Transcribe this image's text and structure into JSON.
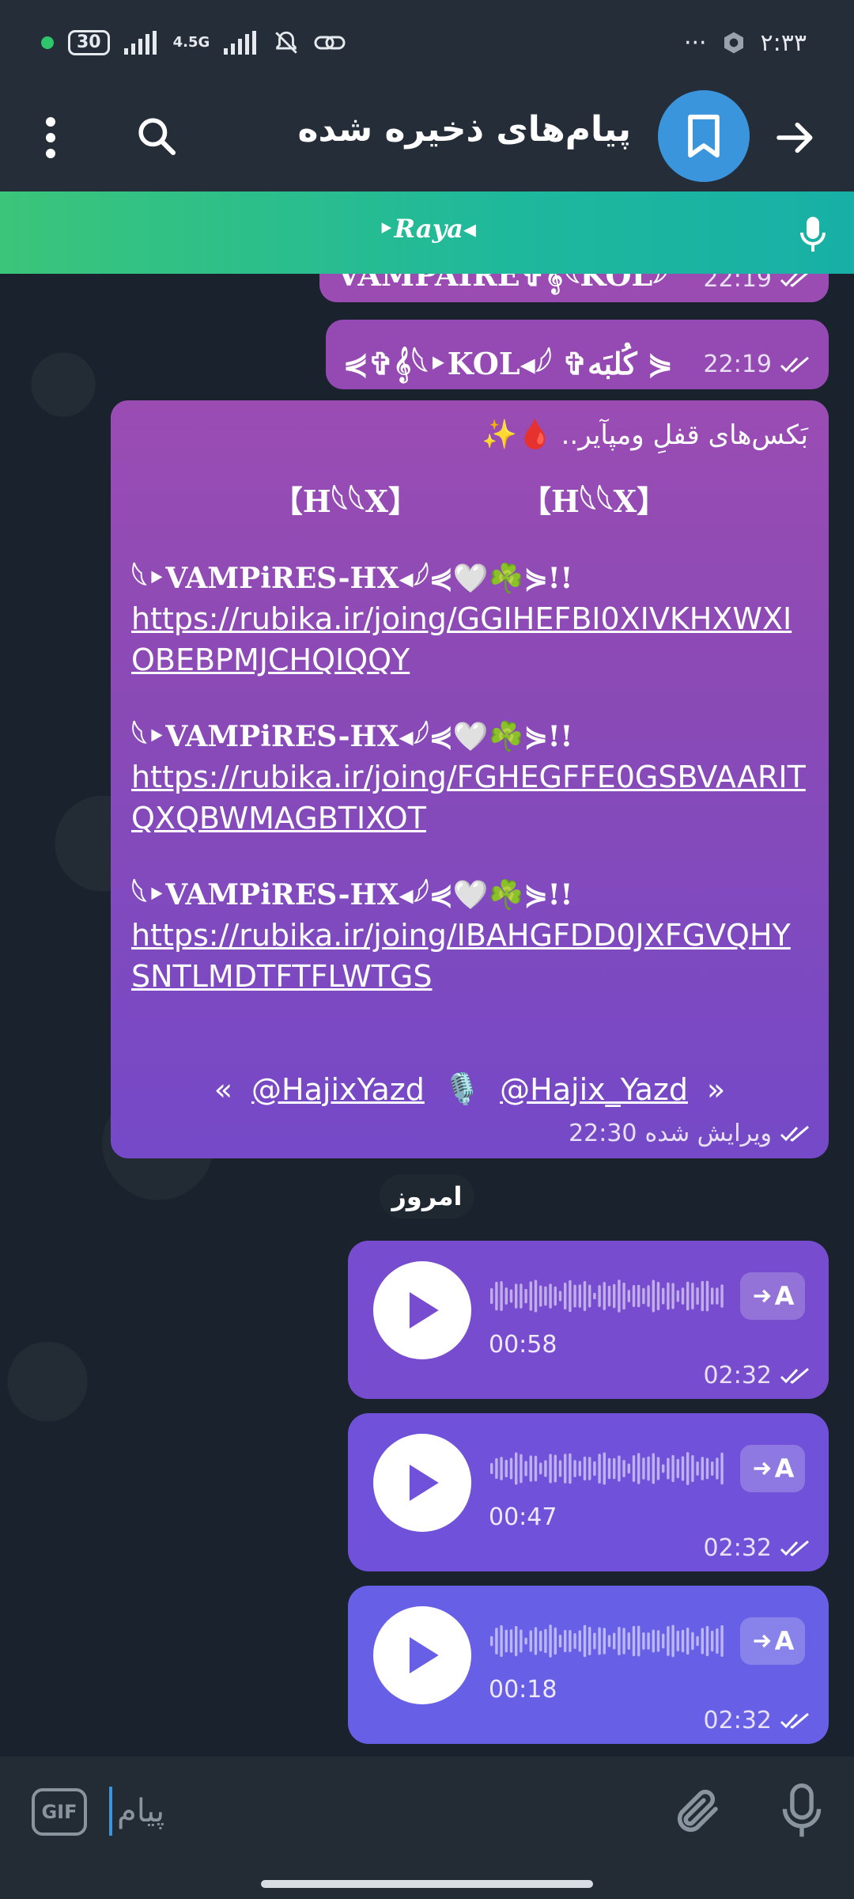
{
  "status_bar": {
    "time": "۲:۳۳",
    "battery": "30",
    "network": "4.5G"
  },
  "header": {
    "title": "پیام‌های ذخیره شده"
  },
  "player": {
    "track": "‣Raya◂"
  },
  "messages": [
    {
      "text": "VAMPAIRE✞𝄞𓆩KOL𓆪",
      "time": "22:19"
    },
    {
      "text": "⋞✞𝄞𓆩‣KOL◂𓆪 ✞كُلبَه ⋟",
      "time": "22:19"
    },
    {
      "heading": "بَکس‌های قفلِ ومپآیر..",
      "heading_emoji": "🩸✨",
      "hx_left": "【H𓆩𓆩X】",
      "hx_right": "【H𓆩𓆩X】",
      "blocks": [
        {
          "title": "𓆩‣VAMPiRES-HX◂𓆪⋞🤍☘️⋟!!",
          "link": "https://rubika.ir/joing/GGIHEFBI0XIVKHXWXIOBEBPMJCHQIQQY"
        },
        {
          "title": "𓆩‣VAMPiRES-HX◂𓆪⋞🤍☘️⋟!!",
          "link": "https://rubika.ir/joing/FGHEGFFE0GSBVAARITQXQBWMAGBTIXOT"
        },
        {
          "title": "𓆩‣VAMPiRES-HX◂𓆪⋞🤍☘️⋟!!",
          "link": "https://rubika.ir/joing/IBAHGFDD0JXFGVQHYSNTLMDTFTFLWTGS"
        }
      ],
      "handle_left": "@HajixYazd",
      "handle_right": "@Hajix_Yazd",
      "quote_left": "«",
      "quote_right": "»",
      "mic_emoji": "🎙️",
      "edited_label": "ویرایش شده",
      "time": "22:30"
    }
  ],
  "date_separator": "امروز",
  "voice_messages": [
    {
      "duration": "00:58",
      "time": "02:32",
      "transcribe": "A"
    },
    {
      "duration": "00:47",
      "time": "02:32",
      "transcribe": "A"
    },
    {
      "duration": "00:18",
      "time": "02:32",
      "transcribe": "A"
    }
  ],
  "input": {
    "placeholder": "پیام",
    "gif_label": "GIF"
  },
  "colors": {
    "accent": "#3a95dd",
    "bubble_purple": "#9a4cb3",
    "voice_violet": "#6760e6",
    "player_green": "#3bc57a"
  }
}
